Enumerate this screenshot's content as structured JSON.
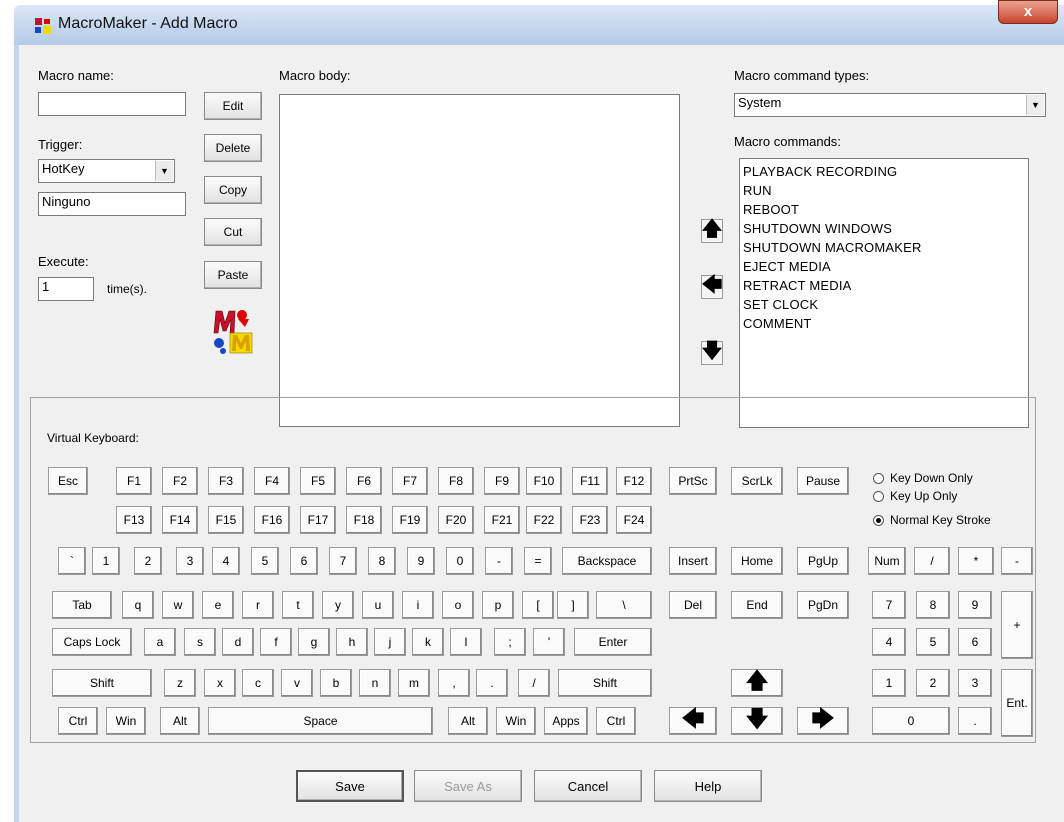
{
  "window": {
    "title": "MacroMaker - Add Macro",
    "close_label": "x"
  },
  "left": {
    "macro_name_label": "Macro name:",
    "macro_name_value": "",
    "trigger_label": "Trigger:",
    "trigger_value": "HotKey",
    "hotkey_value": "Ninguno",
    "execute_label": "Execute:",
    "execute_value": "1",
    "times_label": "time(s).",
    "buttons": {
      "edit": "Edit",
      "delete": "Delete",
      "copy": "Copy",
      "cut": "Cut",
      "paste": "Paste"
    }
  },
  "body": {
    "label": "Macro body:"
  },
  "commands": {
    "types_label": "Macro command types:",
    "types_value": "System",
    "list_label": "Macro commands:",
    "items": [
      "PLAYBACK RECORDING",
      "RUN",
      "REBOOT",
      "SHUTDOWN WINDOWS",
      "SHUTDOWN MACROMAKER",
      "EJECT MEDIA",
      "RETRACT MEDIA",
      "SET CLOCK",
      "COMMENT"
    ]
  },
  "keyboard": {
    "label": "Virtual Keyboard:",
    "keys": {
      "esc": "Esc",
      "f1": "F1",
      "f2": "F2",
      "f3": "F3",
      "f4": "F4",
      "f5": "F5",
      "f6": "F6",
      "f7": "F7",
      "f8": "F8",
      "f9": "F9",
      "f10": "F10",
      "f11": "F11",
      "f12": "F12",
      "f13": "F13",
      "f14": "F14",
      "f15": "F15",
      "f16": "F16",
      "f17": "F17",
      "f18": "F18",
      "f19": "F19",
      "f20": "F20",
      "f21": "F21",
      "f22": "F22",
      "f23": "F23",
      "f24": "F24",
      "prtsc": "PrtSc",
      "scrlk": "ScrLk",
      "pause": "Pause",
      "backtick": "`",
      "d1": "1",
      "d2": "2",
      "d3": "3",
      "d4": "4",
      "d5": "5",
      "d6": "6",
      "d7": "7",
      "d8": "8",
      "d9": "9",
      "d0": "0",
      "minus": "-",
      "equals": "=",
      "backspace": "Backspace",
      "insert": "Insert",
      "home": "Home",
      "pgup": "PgUp",
      "num": "Num",
      "npdiv": "/",
      "npmul": "*",
      "npsub": "-",
      "tab": "Tab",
      "q": "q",
      "w": "w",
      "e": "e",
      "r": "r",
      "t": "t",
      "y": "y",
      "u": "u",
      "i": "i",
      "o": "o",
      "p": "p",
      "lbracket": "[",
      "rbracket": "]",
      "backslash": "\\",
      "del": "Del",
      "end": "End",
      "pgdn": "PgDn",
      "np7": "7",
      "np8": "8",
      "np9": "9",
      "npadd": "+",
      "capslock": "Caps Lock",
      "a": "a",
      "s": "s",
      "d": "d",
      "f": "f",
      "g": "g",
      "h": "h",
      "j": "j",
      "k": "k",
      "l": "l",
      "semicolon": ";",
      "quote": "'",
      "enter": "Enter",
      "np4": "4",
      "np5": "5",
      "np6": "6",
      "lshift": "Shift",
      "z": "z",
      "x": "x",
      "c": "c",
      "v": "v",
      "b": "b",
      "n": "n",
      "m": "m",
      "comma": ",",
      "period": ".",
      "slash": "/",
      "rshift": "Shift",
      "up": "🡅",
      "np1": "1",
      "np2": "2",
      "np3": "3",
      "npent": "Ent.",
      "lctrl": "Ctrl",
      "lwin": "Win",
      "lalt": "Alt",
      "space": "Space",
      "ralt": "Alt",
      "rwin": "Win",
      "apps": "Apps",
      "rctrl": "Ctrl",
      "left": "🡄",
      "down": "🡇",
      "right": "🡆",
      "np0": "0",
      "npdot": "."
    },
    "modes": [
      {
        "label": "Key Down Only",
        "selected": false
      },
      {
        "label": "Key Up Only",
        "selected": false
      },
      {
        "label": "Normal Key Stroke",
        "selected": true
      }
    ]
  },
  "footer": {
    "save": "Save",
    "save_as": "Save As",
    "cancel": "Cancel",
    "help": "Help"
  },
  "icons": {
    "move_up": "arrow-up-icon",
    "move_left": "arrow-left-icon",
    "move_down": "arrow-down-icon",
    "logo": "macromaker-logo-icon"
  }
}
